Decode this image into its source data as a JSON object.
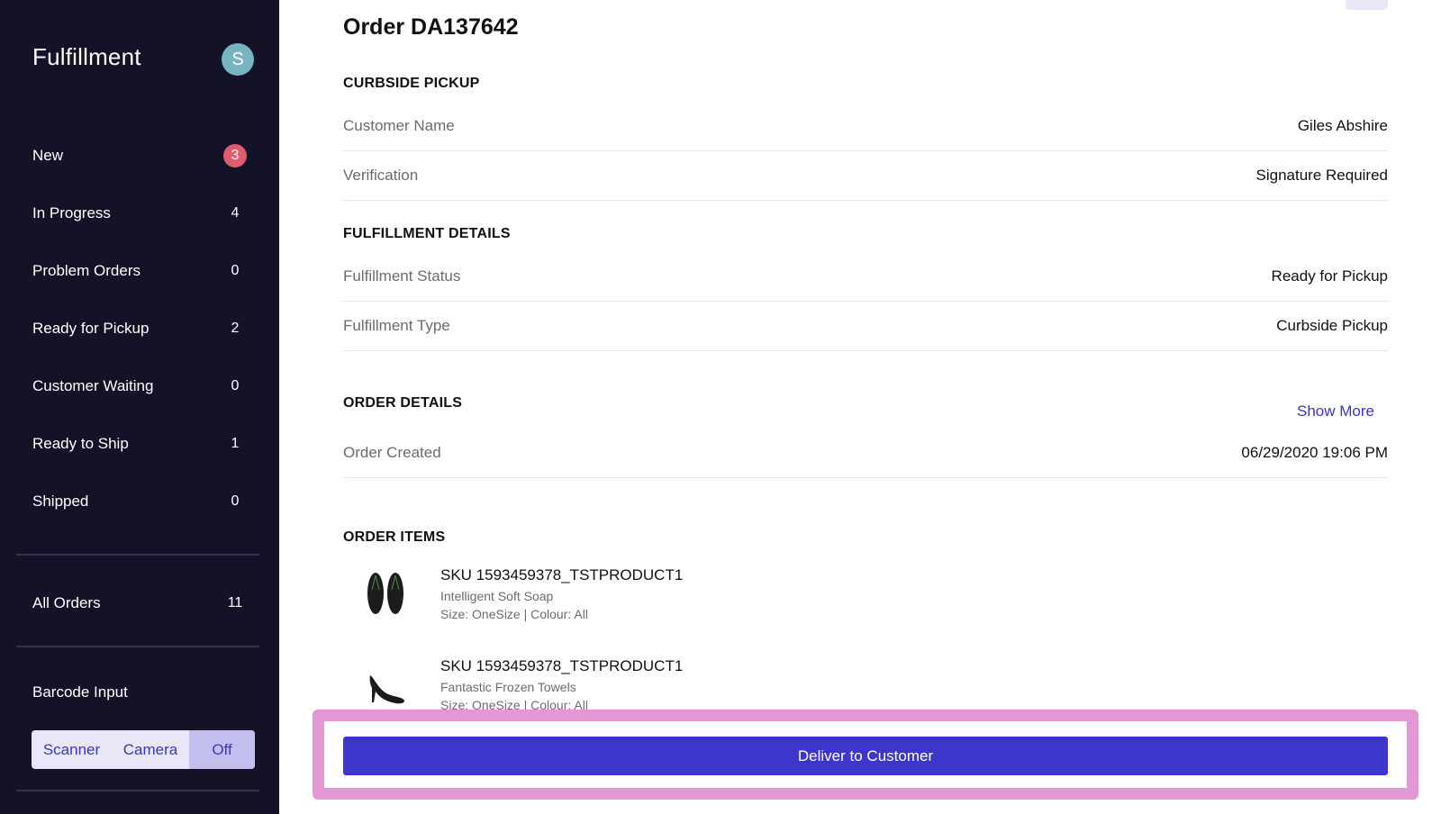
{
  "sidebar": {
    "title": "Fulfillment",
    "avatar_initial": "S",
    "nav": [
      {
        "label": "New",
        "count": "3"
      },
      {
        "label": "In Progress",
        "count": "4"
      },
      {
        "label": "Problem Orders",
        "count": "0"
      },
      {
        "label": "Ready for Pickup",
        "count": "2"
      },
      {
        "label": "Customer Waiting",
        "count": "0"
      },
      {
        "label": "Ready to Ship",
        "count": "1"
      },
      {
        "label": "Shipped",
        "count": "0"
      }
    ],
    "all_orders": {
      "label": "All Orders",
      "count": "11"
    },
    "barcode": {
      "label": "Barcode Input",
      "options": [
        "Scanner",
        "Camera",
        "Off"
      ],
      "selected": "Off"
    }
  },
  "order": {
    "title": "Order DA137642",
    "curbside": {
      "heading": "CURBSIDE PICKUP",
      "rows": [
        {
          "label": "Customer Name",
          "value": "Giles Abshire"
        },
        {
          "label": "Verification",
          "value": "Signature Required"
        }
      ]
    },
    "fulfillment": {
      "heading": "FULFILLMENT DETAILS",
      "rows": [
        {
          "label": "Fulfillment Status",
          "value": "Ready for Pickup"
        },
        {
          "label": "Fulfillment Type",
          "value": "Curbside Pickup"
        }
      ]
    },
    "details": {
      "heading": "ORDER DETAILS",
      "show_more": "Show More",
      "rows": [
        {
          "label": "Order Created",
          "value": "06/29/2020 19:06 PM"
        }
      ]
    },
    "items": {
      "heading": "ORDER ITEMS",
      "list": [
        {
          "sku": "SKU 1593459378_TSTPRODUCT1",
          "name": "Intelligent Soft Soap",
          "meta": "Size: OneSize | Colour: All",
          "image": "flip-flops-icon"
        },
        {
          "sku": "SKU 1593459378_TSTPRODUCT1",
          "name": "Fantastic Frozen Towels",
          "meta": "Size: OneSize | Colour: All",
          "image": "high-heel-shoe-icon"
        }
      ]
    }
  },
  "actions": {
    "deliver_label": "Deliver to Customer"
  },
  "colors": {
    "sidebar_bg": "#131226",
    "accent": "#3d36cd",
    "badge": "#e05c6f",
    "avatar": "#77b4c2",
    "highlight": "#e497d5"
  }
}
